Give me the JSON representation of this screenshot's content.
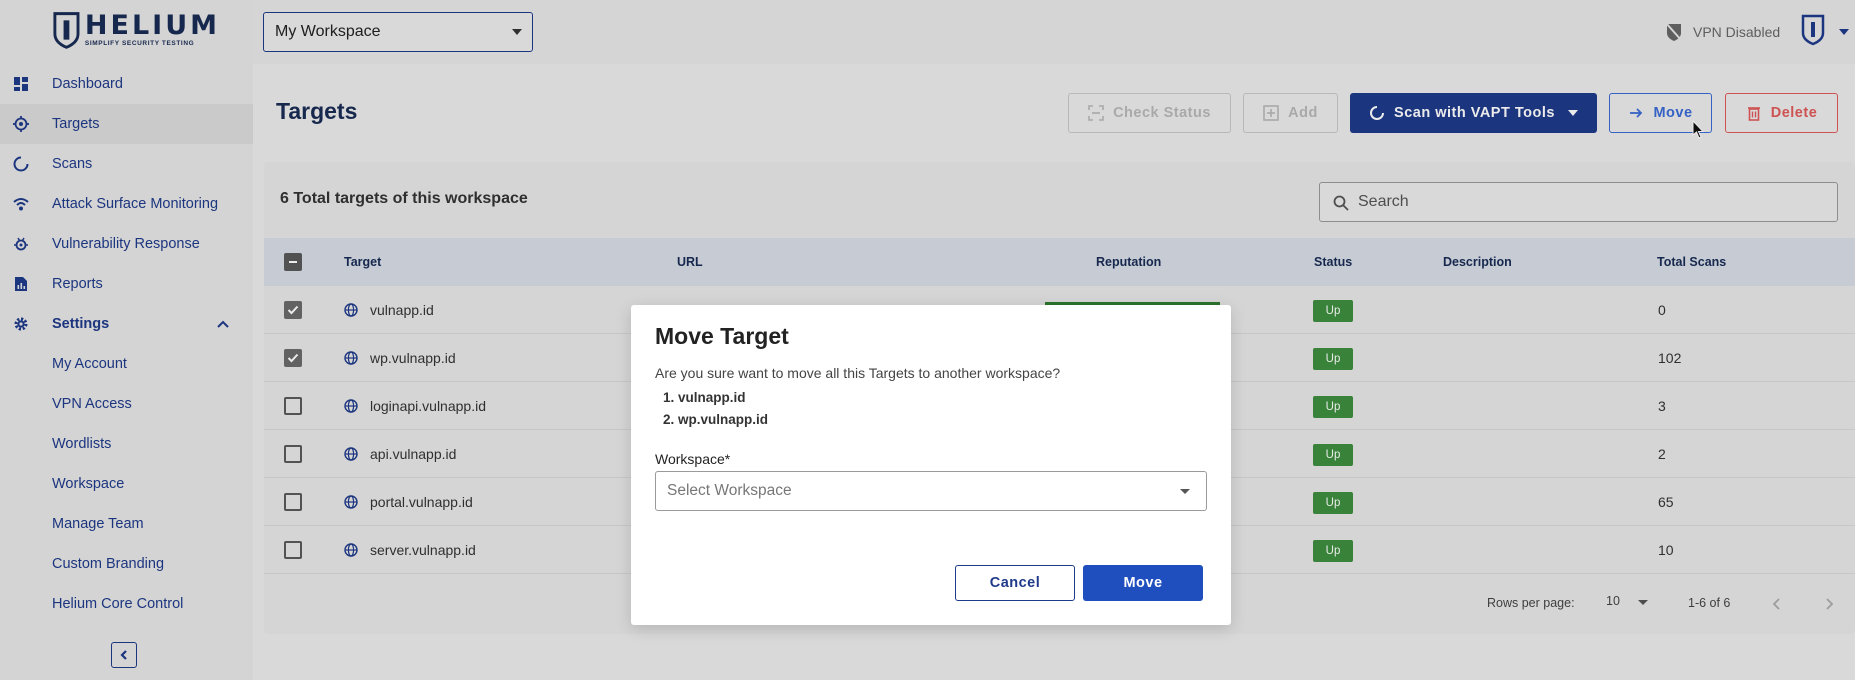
{
  "brand": {
    "name": "HELIUM",
    "tagline": "SIMPLIFY SECURITY TESTING",
    "color": "#1a2c55"
  },
  "topbar": {
    "workspace": "My Workspace",
    "vpn_status": "VPN Disabled"
  },
  "sidebar": {
    "items": [
      {
        "label": "Dashboard",
        "icon": "dashboard-icon"
      },
      {
        "label": "Targets",
        "icon": "target-icon"
      },
      {
        "label": "Scans",
        "icon": "scan-icon"
      },
      {
        "label": "Attack Surface Monitoring",
        "icon": "wifi-icon"
      },
      {
        "label": "Vulnerability Response",
        "icon": "bug-icon"
      },
      {
        "label": "Reports",
        "icon": "report-icon"
      }
    ],
    "settings_label": "Settings",
    "settings_sub": [
      "My Account",
      "VPN Access",
      "Wordlists",
      "Workspace",
      "Manage Team",
      "Custom Branding",
      "Helium Core Control"
    ]
  },
  "page": {
    "title": "Targets",
    "buttons": {
      "check_status": "Check Status",
      "add": "Add",
      "scan": "Scan with VAPT Tools",
      "move": "Move",
      "delete": "Delete"
    },
    "total": "6 Total targets of this workspace",
    "search_placeholder": "Search"
  },
  "table": {
    "headers": [
      "Target",
      "URL",
      "Reputation",
      "Status",
      "Description",
      "Total Scans"
    ],
    "rows": [
      {
        "target": "vulnapp.id",
        "status": "Up",
        "scans": "0",
        "checked": true
      },
      {
        "target": "wp.vulnapp.id",
        "status": "Up",
        "scans": "102",
        "checked": true
      },
      {
        "target": "loginapi.vulnapp.id",
        "status": "Up",
        "scans": "3",
        "checked": false
      },
      {
        "target": "api.vulnapp.id",
        "status": "Up",
        "scans": "2",
        "checked": false
      },
      {
        "target": "portal.vulnapp.id",
        "status": "Up",
        "scans": "65",
        "checked": false
      },
      {
        "target": "server.vulnapp.id",
        "status": "Up",
        "scans": "10",
        "checked": false
      }
    ]
  },
  "pagination": {
    "rows_label": "Rows per page:",
    "rows_value": "10",
    "range": "1-6 of 6"
  },
  "modal": {
    "title": "Move Target",
    "text": "Are you sure want to move all this Targets to another workspace?",
    "list": [
      "1. vulnapp.id",
      "2. wp.vulnapp.id"
    ],
    "label": "Workspace*",
    "placeholder": "Select Workspace",
    "cancel": "Cancel",
    "move": "Move"
  },
  "colors": {
    "primary": "#1f3a8a",
    "status_up": "#3e8e3e",
    "danger": "#e05a5a"
  }
}
